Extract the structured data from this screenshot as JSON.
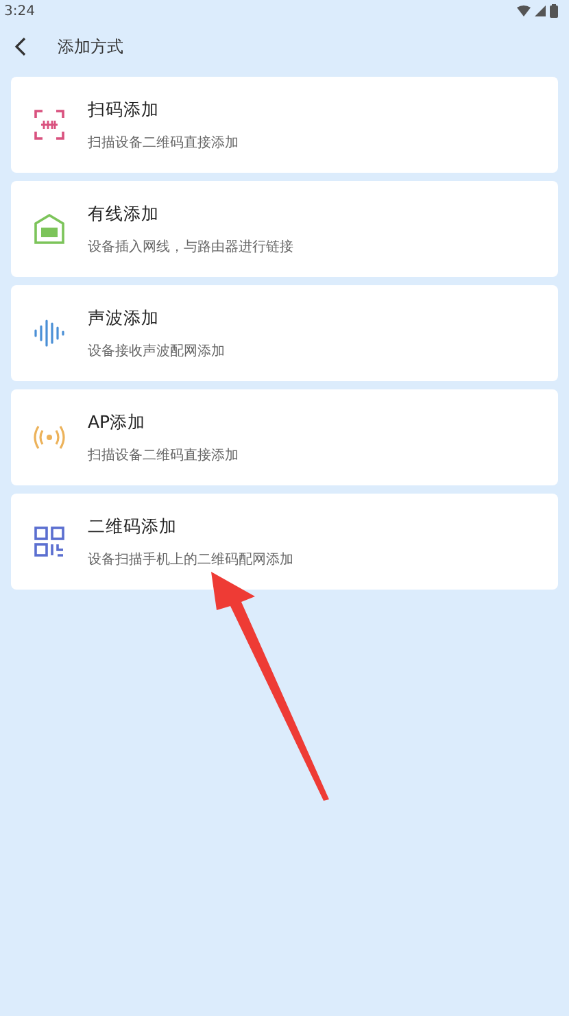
{
  "status_bar": {
    "time": "3:24"
  },
  "header": {
    "title": "添加方式"
  },
  "methods": [
    {
      "kind": "scan",
      "title": "扫码添加",
      "subtitle": "扫描设备二维码直接添加"
    },
    {
      "kind": "wired",
      "title": "有线添加",
      "subtitle": "设备插入网线，与路由器进行链接"
    },
    {
      "kind": "sound",
      "title": "声波添加",
      "subtitle": "设备接收声波配网添加"
    },
    {
      "kind": "ap",
      "title": "AP添加",
      "subtitle": "扫描设备二维码直接添加"
    },
    {
      "kind": "qr",
      "title": "二维码添加",
      "subtitle": "设备扫描手机上的二维码配网添加"
    }
  ]
}
